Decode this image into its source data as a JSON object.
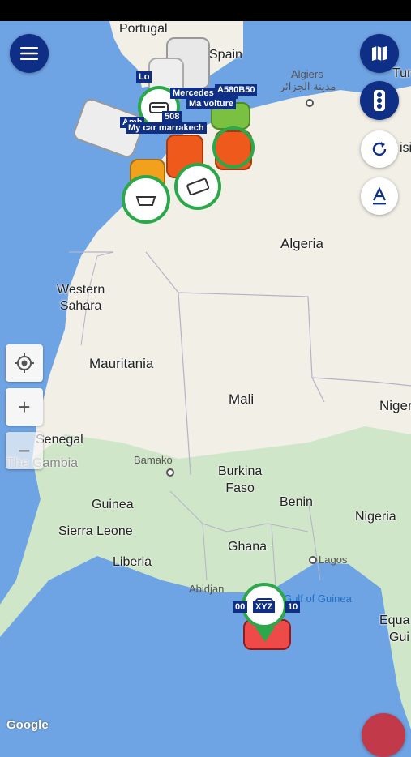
{
  "map": {
    "countries": {
      "portugal": "Portugal",
      "spain": "Spain",
      "algeria": "Algeria",
      "western_sahara": "Western\nSahara",
      "mauritania": "Mauritania",
      "mali": "Mali",
      "niger": "Niger",
      "senegal": "Senegal",
      "gambia": "The Gambia",
      "guinea": "Guinea",
      "sierra_leone": "Sierra Leone",
      "liberia": "Liberia",
      "burkina": "Burkina\nFaso",
      "benin": "Benin",
      "ghana": "Ghana",
      "nigeria": "Nigeria",
      "equatorial": "Equa",
      "gui": "Gui",
      "tunisia": "Tun",
      "tunisia_partial": "isi"
    },
    "cities": {
      "algiers": "Algiers",
      "algiers_ar": "مدينة الجزائر",
      "bamako": "Bamako",
      "abidjan": "Abidjan",
      "lagos": "Lagos"
    },
    "sea": {
      "gulf": "Gulf of Guinea"
    },
    "attribution": "Google"
  },
  "vehicles": [
    {
      "label": "Mercedes GLC"
    },
    {
      "label": "Ma voiture"
    },
    {
      "label": "My car marrakech"
    },
    {
      "label": "508"
    },
    {
      "label": "A580B50"
    },
    {
      "label": "Amb"
    },
    {
      "label": "XYZ"
    }
  ],
  "controls": {
    "menu_icon": "menu-icon",
    "map_type_icon": "map-icon",
    "traffic_icon": "traffic-light-icon",
    "refresh_icon": "refresh-icon",
    "label_icon": "text-label-icon",
    "locate_icon": "crosshair-icon",
    "zoom_in": "+",
    "zoom_out": "−"
  },
  "colors": {
    "navy": "#0f2f86",
    "water": "#6fa4e4",
    "land": "#f2efe7",
    "green_land": "#cfe6c8",
    "marker_green": "#2aa84a",
    "car_orange": "#ef5a1c"
  }
}
